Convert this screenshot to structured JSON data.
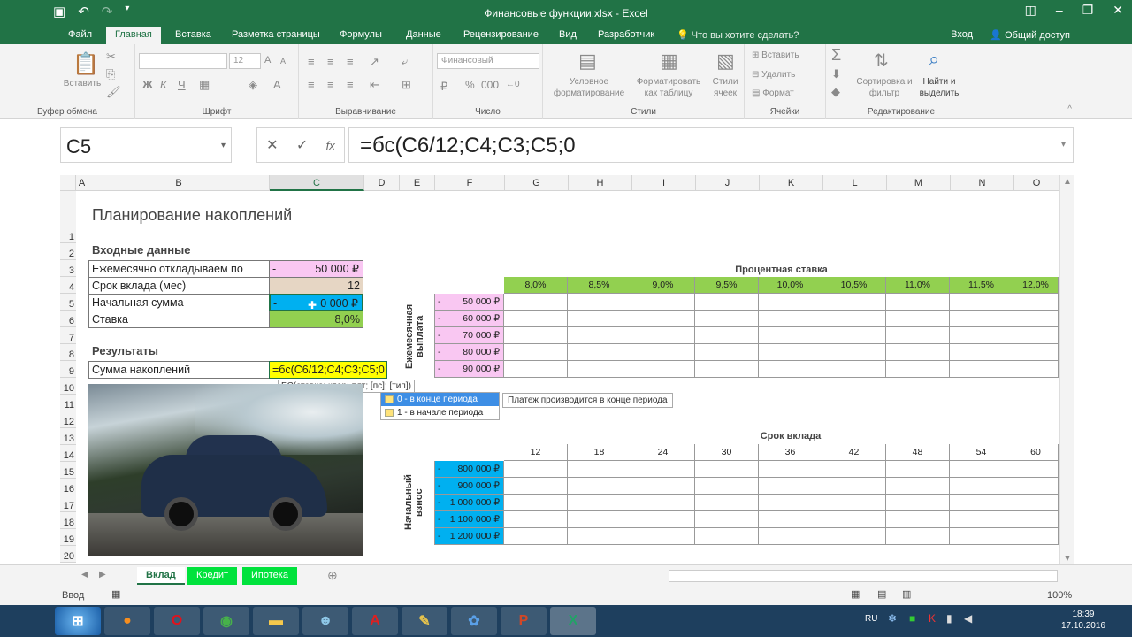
{
  "window": {
    "title": "Финансовые функции.xlsx - Excel"
  },
  "ribbon_tabs": [
    "Файл",
    "Главная",
    "Вставка",
    "Разметка страницы",
    "Формулы",
    "Данные",
    "Рецензирование",
    "Вид",
    "Разработчик"
  ],
  "tell_me": "Что вы хотите сделать?",
  "login": "Вход",
  "share": "Общий доступ",
  "ribbon": {
    "paste": "Вставить",
    "font_size": "12",
    "number_format": "Финансовый",
    "percent": "%",
    "thousands": "000",
    "conditional_fmt": "Условное форматирование",
    "format_table": "Форматировать как таблицу",
    "cell_styles": "Стили ячеек",
    "insert": "Вставить",
    "delete": "Удалить",
    "format": "Формат",
    "sort": "Сортировка и фильтр",
    "find": "Найти и выделить",
    "groups": [
      "Буфер обмена",
      "Шрифт",
      "Выравнивание",
      "Число",
      "Стили",
      "Ячейки",
      "Редактирование"
    ]
  },
  "formula_bar": {
    "name_box": "C5",
    "formula": "=бс(C6/12;C4;C3;C5;0"
  },
  "columns": [
    "A",
    "B",
    "C",
    "D",
    "E",
    "F",
    "G",
    "H",
    "I",
    "J",
    "K",
    "L",
    "M",
    "N",
    "O"
  ],
  "rows": [
    "1",
    "2",
    "3",
    "4",
    "5",
    "6",
    "7",
    "8",
    "9",
    "10",
    "11",
    "12",
    "13",
    "14",
    "15",
    "16",
    "17",
    "18",
    "19",
    "20"
  ],
  "sheet": {
    "title": "Планирование накоплений",
    "inputs_header": "Входные данные",
    "results_header": "Результаты",
    "b3": "Ежемесячно откладываем по",
    "c3_sign": "-",
    "c3": "50 000 ₽",
    "b4": "Срок вклада (мес)",
    "c4": "12",
    "b5": "Начальная сумма",
    "c5_sign": "-",
    "c5": "0 000 ₽",
    "b6": "Ставка",
    "c6": "8,0%",
    "b9": "Сумма накоплений",
    "c9_formula": "=бс(C6/12;C4;C3;C5;0"
  },
  "rate_table": {
    "title": "Процентная ставка",
    "side_label": "Ежемесячная выплата",
    "rates": [
      "8,0%",
      "8,5%",
      "9,0%",
      "9,5%",
      "10,0%",
      "10,5%",
      "11,0%",
      "11,5%",
      "12,0%"
    ],
    "payments": [
      "50 000 ₽",
      "60 000 ₽",
      "70 000 ₽",
      "80 000 ₽",
      "90 000 ₽"
    ]
  },
  "term_table": {
    "title": "Срок вклада",
    "side_label": "Начальный взнос",
    "terms": [
      "12",
      "18",
      "24",
      "30",
      "36",
      "42",
      "48",
      "54",
      "60"
    ],
    "deposits": [
      "800 000 ₽",
      "900 000 ₽",
      "1 000 000 ₽",
      "1 100 000 ₽",
      "1 200 000 ₽"
    ]
  },
  "tooltip": "БС(ставка; кпер; плт; [пс]; [тип])",
  "autocomplete": [
    "0 - в конце периода",
    "1 - в начале периода"
  ],
  "autocomplete_hint": "Платеж производится в конце периода",
  "sheet_tabs": [
    "Вклад",
    "Кредит",
    "Ипотека"
  ],
  "status": {
    "mode": "Ввод",
    "zoom": "100%"
  },
  "taskbar": {
    "lang": "RU",
    "time": "18:39",
    "date": "17.10.2016"
  }
}
